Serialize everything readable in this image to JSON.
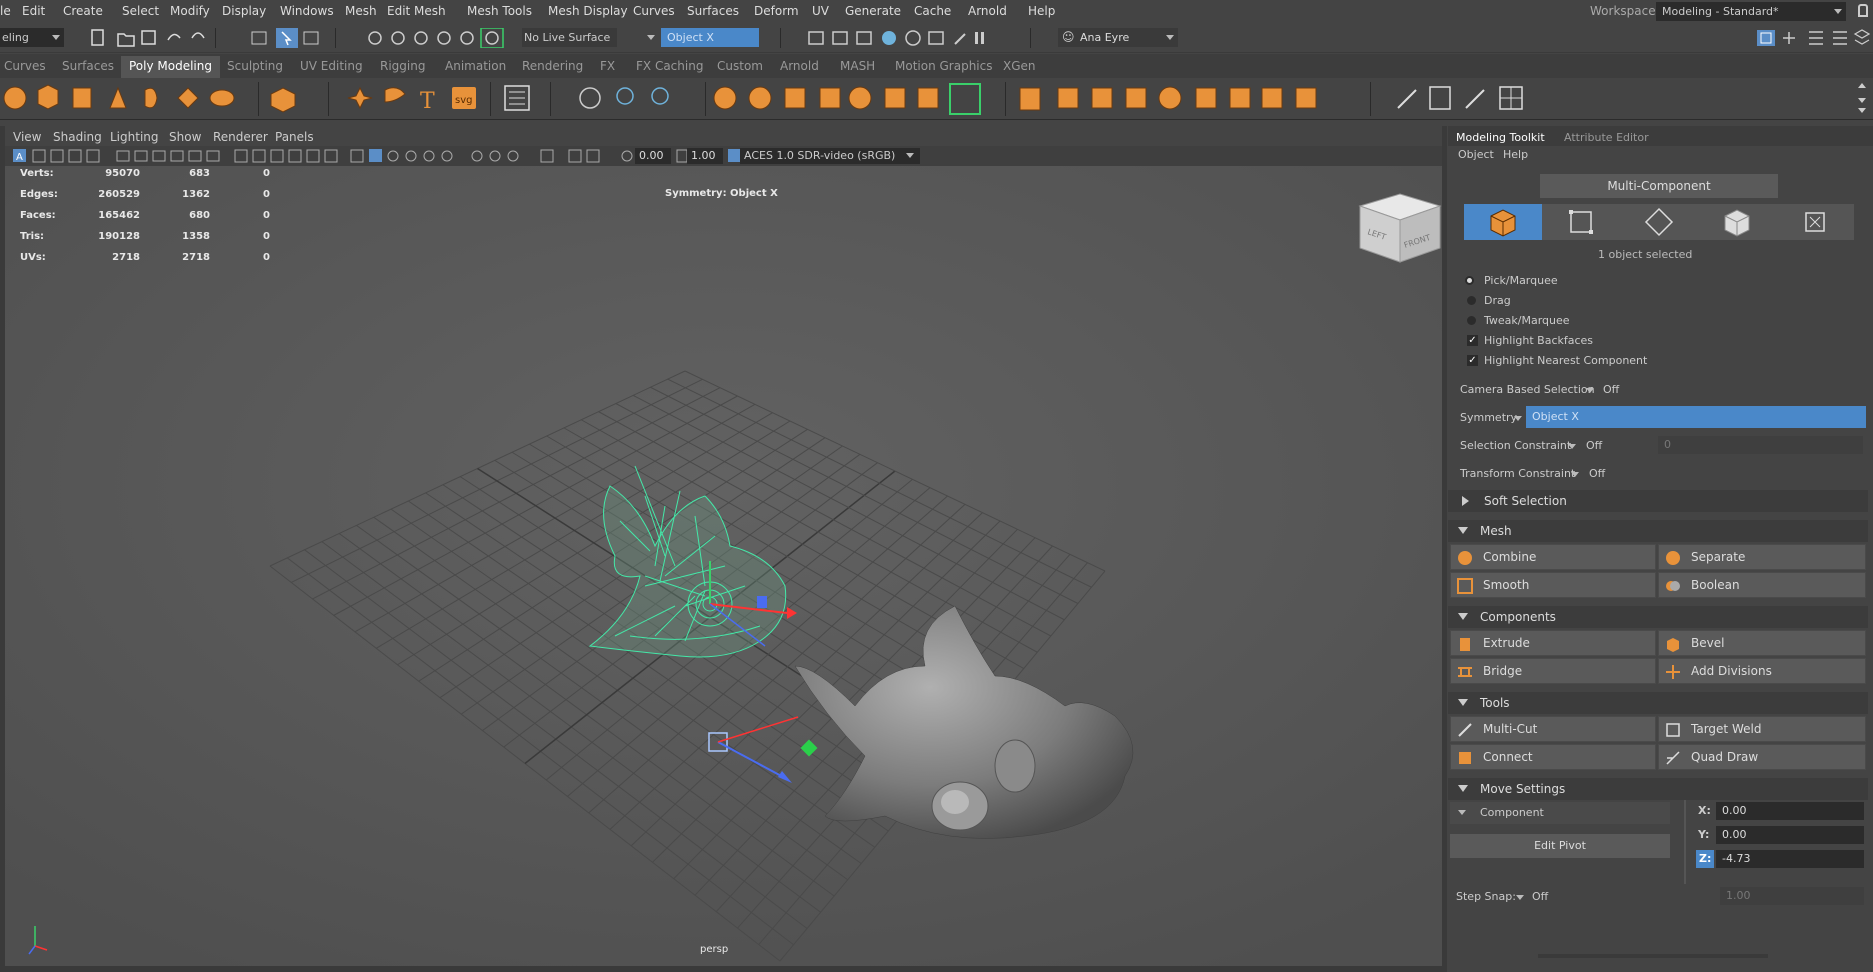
{
  "menubar": {
    "items": [
      "le",
      "Edit",
      "Create",
      "Select",
      "Modify",
      "Display",
      "Windows",
      "Mesh",
      "Edit Mesh",
      "Mesh Tools",
      "Mesh Display",
      "Curves",
      "Surfaces",
      "Deform",
      "UV",
      "Generate",
      "Cache",
      "Arnold",
      "Help"
    ],
    "workspace_label": "Workspace:",
    "workspace_value": "Modeling - Standard*"
  },
  "statusline": {
    "mode_value": "eling",
    "live_surface": "No Live Surface",
    "symmetry_value": "Object X",
    "user_name": "Ana Eyre"
  },
  "shelf_tabs": [
    "Curves",
    "Surfaces",
    "Poly Modeling",
    "Sculpting",
    "UV Editing",
    "Rigging",
    "Animation",
    "Rendering",
    "FX",
    "FX Caching",
    "Custom",
    "Arnold",
    "MASH",
    "Motion Graphics",
    "XGen"
  ],
  "shelf_active": "Poly Modeling",
  "shelf_svg_label": "svg",
  "viewport": {
    "menus": [
      "View",
      "Shading",
      "Lighting",
      "Show",
      "Renderer",
      "Panels"
    ],
    "toolbar": {
      "exposure": "0.00",
      "gamma": "1.00",
      "colorspace": "ACES 1.0 SDR-video (sRGB)"
    },
    "hud": {
      "rows": [
        {
          "label": "Verts:",
          "a": "95070",
          "b": "683",
          "c": "0"
        },
        {
          "label": "Edges:",
          "a": "260529",
          "b": "1362",
          "c": "0"
        },
        {
          "label": "Faces:",
          "a": "165462",
          "b": "680",
          "c": "0"
        },
        {
          "label": "Tris:",
          "a": "190128",
          "b": "1358",
          "c": "0"
        },
        {
          "label": "UVs:",
          "a": "2718",
          "b": "2718",
          "c": "0"
        }
      ],
      "symmetry": "Symmetry: Object X",
      "camera": "persp"
    },
    "viewcube": {
      "left": "LEFT",
      "front": "FRONT"
    }
  },
  "panel": {
    "tabs": [
      "Modeling Toolkit",
      "Attribute Editor"
    ],
    "submenus": [
      "Object",
      "Help"
    ],
    "mode_button": "Multi-Component",
    "selection_status": "1 object selected",
    "pick_options": [
      "Pick/Marquee",
      "Drag",
      "Tweak/Marquee"
    ],
    "checks": [
      "Highlight Backfaces",
      "Highlight Nearest Component"
    ],
    "camera_based_label": "Camera Based Selection",
    "camera_based_value": "Off",
    "symmetry_label": "Symmetry",
    "symmetry_value": "Object X",
    "sel_constraint_label": "Selection Constraint",
    "sel_constraint_value": "Off",
    "sel_constraint_num": "0",
    "transform_constraint_label": "Transform Constraint",
    "transform_constraint_value": "Off",
    "soft_selection": "Soft Selection",
    "mesh_section": "Mesh",
    "mesh_buttons": [
      "Combine",
      "Separate",
      "Smooth",
      "Boolean"
    ],
    "components_section": "Components",
    "components_buttons": [
      "Extrude",
      "Bevel",
      "Bridge",
      "Add Divisions"
    ],
    "tools_section": "Tools",
    "tools_buttons": [
      "Multi-Cut",
      "Target Weld",
      "Connect",
      "Quad Draw"
    ],
    "move_section": "Move Settings",
    "move_mode": "Component",
    "edit_pivot": "Edit Pivot",
    "x_label": "X:",
    "x_value": "0.00",
    "y_label": "Y:",
    "y_value": "0.00",
    "z_label": "Z:",
    "z_value": "-4.73",
    "step_snap_label": "Step Snap:",
    "step_snap_value": "Off",
    "step_snap_num": "1.00"
  },
  "colors": {
    "accent": "#4a88c9",
    "selection_wire": "#44e8a8",
    "orange_icon": "#e8923a"
  }
}
